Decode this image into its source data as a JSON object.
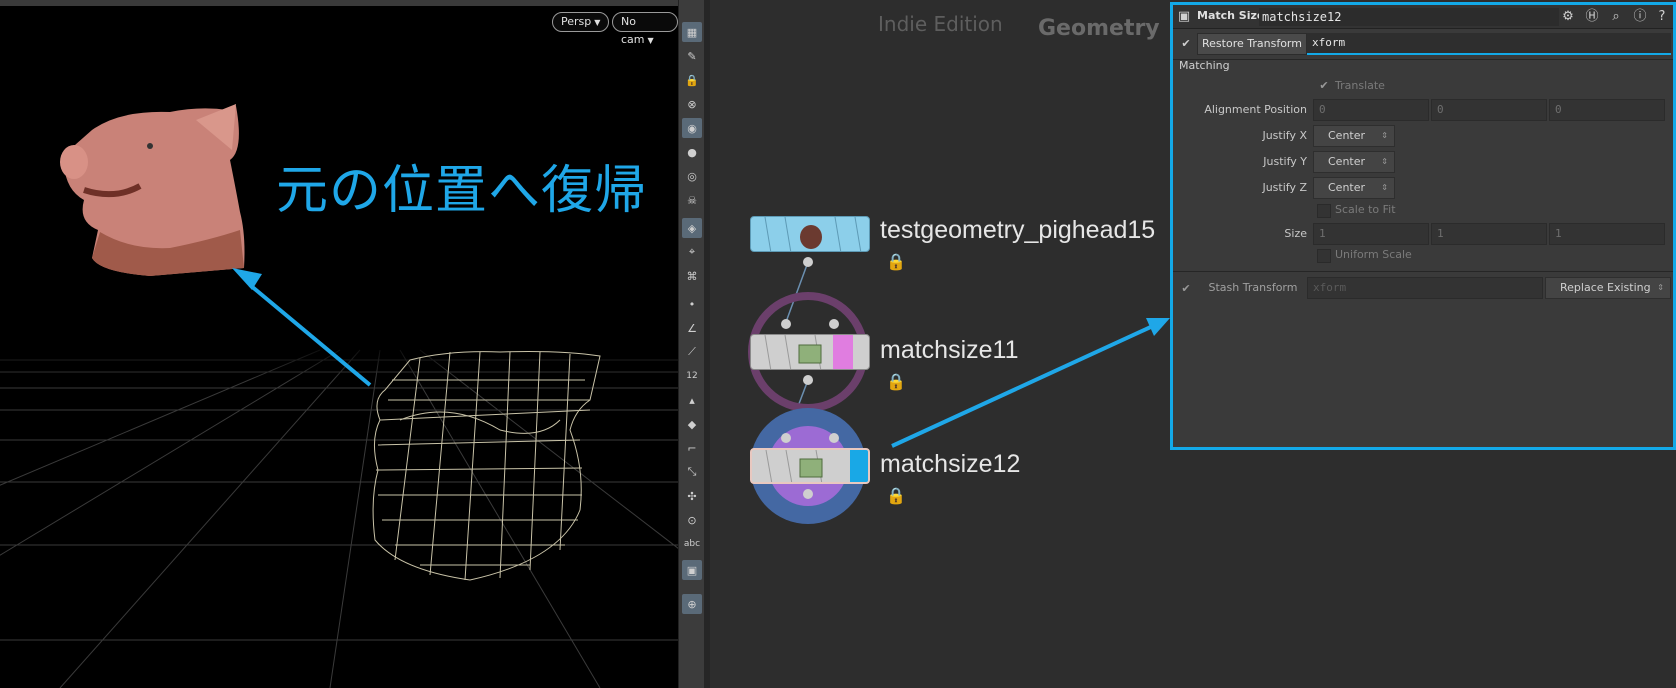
{
  "viewport": {
    "camera_label": "Persp",
    "cam_label": "No cam",
    "annotation": "元の位置へ復帰"
  },
  "toolbar": {
    "icons": [
      "display-options-icon",
      "select-icon",
      "lock-icon",
      "ghost-icon",
      "view-icon",
      "light-icon",
      "light2-icon",
      "skull-icon",
      "camera-icon",
      "geometry-icon",
      "render-icon",
      "point-icon",
      "edge-icon",
      "primitive-icon",
      "number-icon",
      "paint-icon",
      "vertex-number-icon",
      "corner-icon",
      "scale-icon",
      "handle-icon",
      "stop-icon",
      "text-icon",
      "image-icon",
      "pin-icon"
    ],
    "number_label": "12",
    "text_label": "abc"
  },
  "network": {
    "edition": "Indie Edition",
    "context": "Geometry",
    "nodes": [
      {
        "name": "testgeometry_pighead15"
      },
      {
        "name": "matchsize11"
      },
      {
        "name": "matchsize12"
      }
    ]
  },
  "params": {
    "node_type": "Match Size",
    "node_name": "matchsize12",
    "restore_transform_label": "Restore Transform",
    "restore_transform_value": "xform",
    "section_label": "Matching",
    "translate_label": "Translate",
    "alignment_position_label": "Alignment Position",
    "alignment_position": [
      "0",
      "0",
      "0"
    ],
    "justify_x_label": "Justify X",
    "justify_x": "Center",
    "justify_y_label": "Justify Y",
    "justify_y": "Center",
    "justify_z_label": "Justify Z",
    "justify_z": "Center",
    "scale_to_fit_label": "Scale to Fit",
    "size_label": "Size",
    "size": [
      "1",
      "1",
      "1"
    ],
    "uniform_scale_label": "Uniform Scale",
    "stash_transform_label": "Stash Transform",
    "stash_transform_value": "xform",
    "replace_existing_label": "Replace Existing"
  },
  "colors": {
    "accent": "#13a9e8",
    "annotation": "#1fa7e8",
    "node_flag_pink": "#e07de0",
    "node_flag_blue": "#19a8e6"
  }
}
